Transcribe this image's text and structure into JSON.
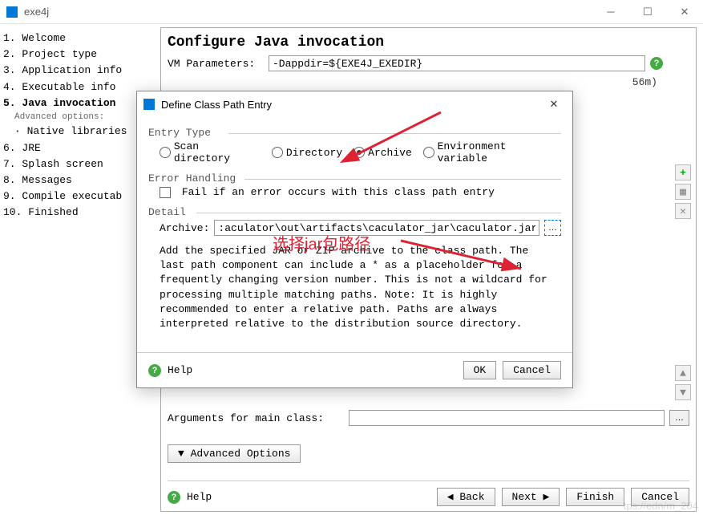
{
  "window": {
    "title": "exe4j"
  },
  "sidebar": {
    "items": [
      "1. Welcome",
      "2. Project type",
      "3. Application info",
      "4. Executable info",
      "5. Java invocation",
      "6. JRE",
      "7. Splash screen",
      "8. Messages",
      "9. Compile executab",
      "10. Finished"
    ],
    "advanced_label": "Advanced options:",
    "native_lib": "· Native libraries"
  },
  "content": {
    "heading": "Configure Java invocation",
    "vm_label": "VM Parameters:",
    "vm_value": "-Dappdir=${EXE4J_EXEDIR}",
    "trailing_text": "56m)",
    "args_label": "Arguments for main class:",
    "adv_options": "▼ Advanced Options",
    "help": "Help",
    "back": "◀ Back",
    "next": "Next ▶",
    "finish": "Finish",
    "cancel": "Cancel"
  },
  "dialog": {
    "title": "Define Class Path Entry",
    "entry_type": "Entry Type",
    "radios": {
      "scan": "Scan directory",
      "dir": "Directory",
      "archive": "Archive",
      "env": "Environment variable"
    },
    "error_handling": "Error Handling",
    "fail_label": "Fail if an error occurs with this class path entry",
    "detail": "Detail",
    "archive_label": "Archive:",
    "archive_value": ":aculator\\out\\artifacts\\caculator_jar\\caculator.jar",
    "description": "Add the specified JAR or ZIP archive to the class path. The last path component can include a * as a placeholder for a frequently changing version number. This is not a wildcard for processing multiple matching paths. Note: It is highly recommended to enter a relative path. Paths are always interpreted relative to the distribution source directory.",
    "help": "Help",
    "ok": "OK",
    "cancel": "Cancel"
  },
  "annotations": {
    "red_text": "选择jar包路径",
    "watermark": "tps://edn/m_204"
  }
}
